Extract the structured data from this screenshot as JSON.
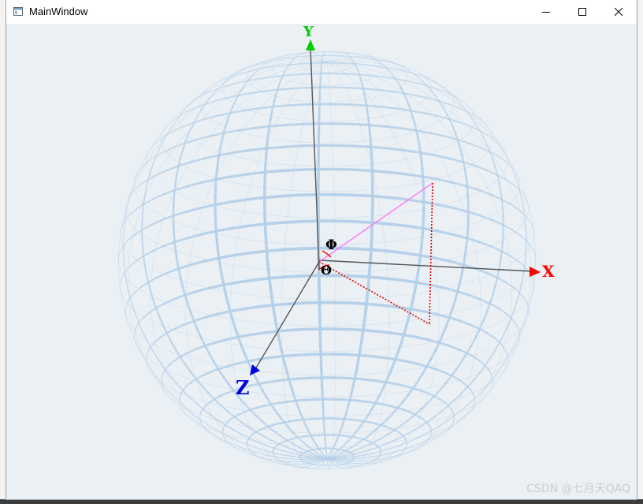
{
  "window": {
    "title": "MainWindow",
    "controls": [
      "minimize",
      "maximize",
      "close"
    ]
  },
  "scene": {
    "axes": {
      "x_label": "X",
      "y_label": "Y",
      "z_label": "Z"
    },
    "angles": {
      "phi": "Φ",
      "theta": "Θ"
    },
    "sphere_color": "#b4cfe8",
    "x_axis_color": "#ff0000",
    "y_axis_color": "#00cc00",
    "z_axis_color": "#0000dd",
    "vector_color": "#ff66ff",
    "projection_color": "#dd0000"
  },
  "watermark": "CSDN @七月天QAQ"
}
